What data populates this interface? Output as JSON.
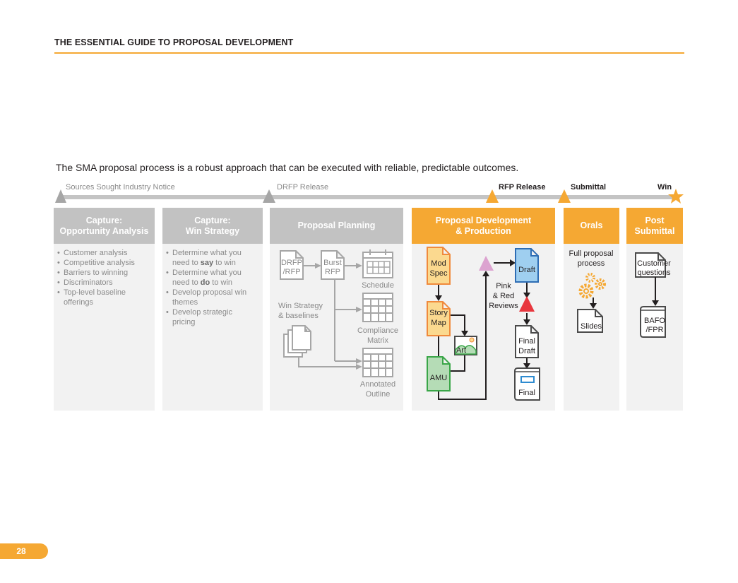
{
  "header": {
    "title": "THE ESSENTIAL GUIDE TO PROPOSAL DEVELOPMENT"
  },
  "intro": "The SMA proposal process is a robust approach that can be executed with reliable, predictable outcomes.",
  "timeline": {
    "milestones": [
      {
        "label": "Sources Sought Industry Notice",
        "marker": "triangle",
        "color": "#a6a6a6"
      },
      {
        "label": "DRFP Release",
        "marker": "triangle",
        "color": "#a6a6a6"
      },
      {
        "label": "RFP Release",
        "marker": "triangle",
        "color": "#f5a833"
      },
      {
        "label": "Submittal",
        "marker": "triangle",
        "color": "#f5a833"
      },
      {
        "label": "Win",
        "marker": "star",
        "color": "#f5a833"
      }
    ]
  },
  "columns": {
    "opportunity": {
      "title_line1": "Capture:",
      "title_line2": "Opportunity Analysis",
      "bullets": [
        "Customer analysis",
        "Competitive analysis",
        "Barriers to winning",
        "Discriminators",
        "Top-level baseline offerings"
      ]
    },
    "win_strategy": {
      "title_line1": "Capture:",
      "title_line2": "Win Strategy",
      "bullets": [
        {
          "pre": "Determine what you need to ",
          "em": "say",
          "post": " to win"
        },
        {
          "pre": "Determine what you need to ",
          "em": "do",
          "post": " to win"
        },
        {
          "pre": "Develop proposal win themes",
          "em": "",
          "post": ""
        },
        {
          "pre": "Develop strategic pricing",
          "em": "",
          "post": ""
        }
      ]
    },
    "planning": {
      "title": "Proposal Planning",
      "drfp_line1": "DRFP",
      "drfp_line2": "/RFP",
      "burst_line1": "Burst",
      "burst_line2": "RFP",
      "schedule": "Schedule",
      "win_strategy_line1": "Win Strategy",
      "win_strategy_line2": "& baselines",
      "compliance_line1": "Compliance",
      "compliance_line2": "Matrix",
      "annotated_line1": "Annotated",
      "annotated_line2": "Outline"
    },
    "development": {
      "title_line1": "Proposal Development",
      "title_line2": "& Production",
      "mod_line1": "Mod",
      "mod_line2": "Spec",
      "story_line1": "Story",
      "story_line2": "Map",
      "art": "Art",
      "amu": "AMU",
      "draft": "Draft",
      "reviews_line1": "Pink",
      "reviews_line2": "& Red",
      "reviews_line3": "Reviews",
      "final_draft_line1": "Final",
      "final_draft_line2": "Draft",
      "final": "Final",
      "colors": {
        "mod_fill": "#fbd98f",
        "mod_stroke": "#f08a3c",
        "amu_fill": "#b5dcb6",
        "amu_stroke": "#3aa648",
        "draft_fill": "#9fcff0",
        "draft_stroke": "#2e6db4",
        "pink": "#dca3d0",
        "red": "#e8373e"
      }
    },
    "orals": {
      "title": "Orals",
      "desc_line1": "Full proposal",
      "desc_line2": "process",
      "slides": "Slides"
    },
    "post": {
      "title_line1": "Post",
      "title_line2": "Submittal",
      "customer_line1": "Customer",
      "customer_line2": "questions",
      "bafo_line1": "BAFO",
      "bafo_line2": "/FPR"
    }
  },
  "page_number": "28"
}
